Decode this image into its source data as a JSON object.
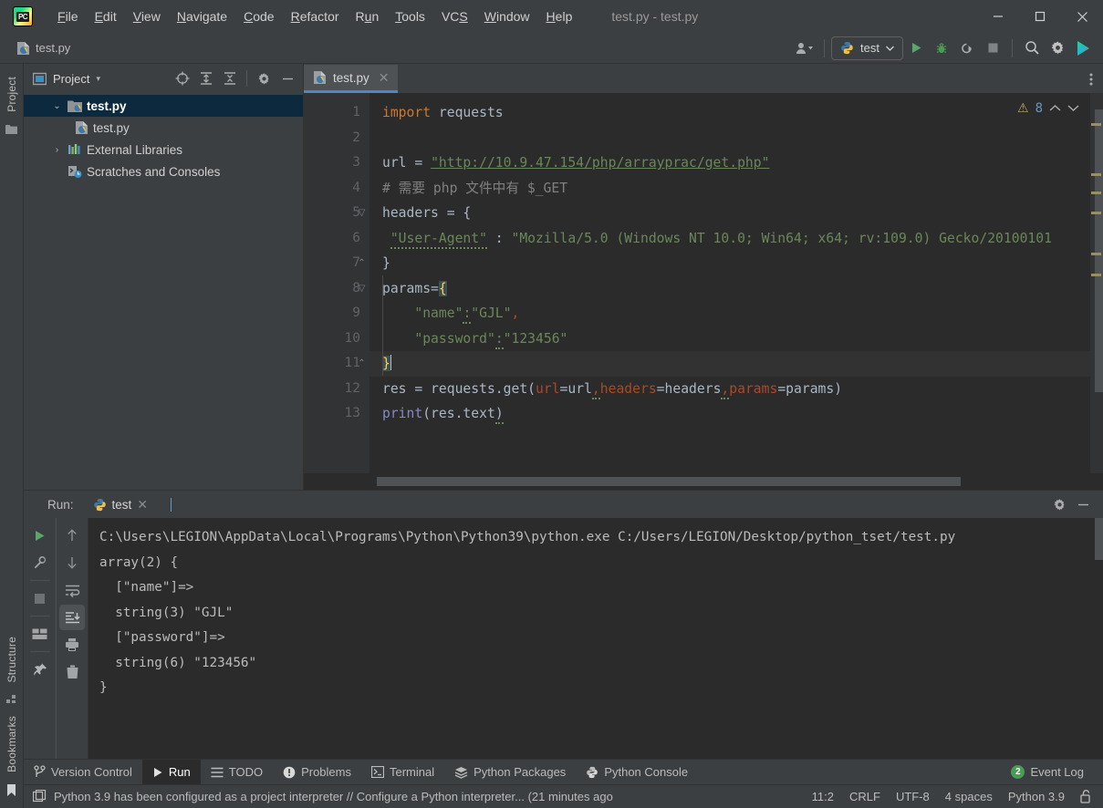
{
  "window": {
    "title": "test.py - test.py",
    "app_icon": "pycharm-logo-icon",
    "minimize": "–",
    "maximize": "□",
    "close": "✕"
  },
  "menubar": {
    "items": [
      {
        "label": "File",
        "mnemonic": "F"
      },
      {
        "label": "Edit",
        "mnemonic": "E"
      },
      {
        "label": "View",
        "mnemonic": "V"
      },
      {
        "label": "Navigate",
        "mnemonic": "N"
      },
      {
        "label": "Code",
        "mnemonic": "C"
      },
      {
        "label": "Refactor",
        "mnemonic": "R"
      },
      {
        "label": "Run",
        "mnemonic": "u"
      },
      {
        "label": "Tools",
        "mnemonic": "T"
      },
      {
        "label": "VCS",
        "mnemonic": "S"
      },
      {
        "label": "Window",
        "mnemonic": "W"
      },
      {
        "label": "Help",
        "mnemonic": "H"
      }
    ]
  },
  "navbar": {
    "breadcrumb": "test.py",
    "breadcrumb_icon": "python-file-icon",
    "account_icon": "user-account-icon",
    "run_config": {
      "label": "test",
      "icon": "python-icon",
      "chevron": "▾"
    },
    "buttons": [
      {
        "name": "run-button",
        "icon": "play-icon",
        "color": "#59a869"
      },
      {
        "name": "debug-button",
        "icon": "bug-icon",
        "color": "#499c54"
      },
      {
        "name": "run-with-coverage-button",
        "icon": "coverage-icon",
        "color": "#a9abad"
      },
      {
        "name": "stop-button",
        "icon": "stop-square-icon",
        "color": "#7f8386"
      },
      {
        "name": "search-everywhere-button",
        "icon": "search-icon",
        "color": "#c0c0c0"
      },
      {
        "name": "settings-button",
        "icon": "gear-icon",
        "color": "#c0c0c0"
      },
      {
        "name": "ai-assistant-button",
        "icon": "play-colored-icon",
        "color": "#21d789"
      }
    ]
  },
  "left_strip": {
    "project_label": "Project",
    "project_folder_icon": "folder-icon",
    "structure_label": "Structure",
    "structure_icon": "structure-icon",
    "bookmarks_label": "Bookmarks",
    "bookmarks_icon": "bookmark-icon"
  },
  "project_panel": {
    "title": "Project",
    "title_icon": "project-window-icon",
    "chevron": "▾",
    "toolbar": [
      {
        "name": "select-opened-file-button",
        "icon": "crosshair-icon"
      },
      {
        "name": "expand-all-button",
        "icon": "expand-all-icon"
      },
      {
        "name": "collapse-all-button",
        "icon": "collapse-all-icon"
      },
      {
        "name": "panel-options-button",
        "icon": "gear-icon"
      },
      {
        "name": "hide-panel-button",
        "icon": "minus-icon"
      }
    ],
    "tree": [
      {
        "label": "test.py",
        "icon": "project-folder-icon",
        "arrow": "⌄",
        "level": 1,
        "selected": true,
        "bold": true
      },
      {
        "label": "test.py",
        "icon": "python-file-icon",
        "arrow": "",
        "level": 2,
        "selected": false,
        "bold": false
      },
      {
        "label": "External Libraries",
        "icon": "libraries-icon",
        "arrow": "›",
        "level": 1,
        "selected": false,
        "bold": false
      },
      {
        "label": "Scratches and Consoles",
        "icon": "scratches-icon",
        "arrow": "",
        "level": 1,
        "selected": false,
        "bold": false
      }
    ]
  },
  "editor": {
    "tab": {
      "label": "test.py",
      "icon": "python-file-icon",
      "close": "✕"
    },
    "more_icon": "vertical-dots-icon",
    "inspections": {
      "warning_icon": "warning-triangle-icon",
      "count": "8",
      "prev": "⌃",
      "next": "⌄"
    },
    "lines": [
      {
        "n": "1",
        "html": "<span class='k'>import</span> requests"
      },
      {
        "n": "2",
        "html": ""
      },
      {
        "n": "3",
        "html": "url = <span class='s url'>\"http://10.9.47.154/php/arrayprac/get.php\"</span>"
      },
      {
        "n": "4",
        "html": "<span class='cm'># 需要 php 文件中有 $_GET</span>"
      },
      {
        "n": "5",
        "html": "headers = {"
      },
      {
        "n": "6",
        "html": " <span class='s squig'>\"User-Agent\"</span> : <span class='s'>\"Mozilla/5.0 (Windows NT 10.0; Win64; x64; rv:109.0) Gecko/20100101</span>"
      },
      {
        "n": "7",
        "html": "}"
      },
      {
        "n": "8",
        "html": "params=<span class='brace-hl'>{</span>"
      },
      {
        "n": "9",
        "html": "    <span class='s'>\"name\"</span><span class='s squig'>:</span><span class='s'>\"GJL\"</span><span class='kwarg'>,</span>"
      },
      {
        "n": "10",
        "html": "    <span class='s'>\"password\"</span><span class='s squig'>:</span><span class='s'>\"123456\"</span>"
      },
      {
        "n": "11",
        "html": "<span class='brace-hl'>}</span><span class='caret'></span>",
        "current": true
      },
      {
        "n": "12",
        "html": "res = requests.get(<span class='kwarg'>url</span>=url<span class='kwarg squig'>,</span><span class='kwarg'>headers</span>=headers<span class='kwarg squig'>,</span><span class='kwarg'>params</span>=params)"
      },
      {
        "n": "13",
        "html": "<span class='fn'>print</span>(res.text<span class='squig'>)</span>"
      }
    ],
    "source_text": [
      "import requests",
      "",
      "url = \"http://10.9.47.154/php/arrayprac/get.php\"",
      "# 需要 php 文件中有 $_GET",
      "headers = {",
      " \"User-Agent\" : \"Mozilla/5.0 (Windows NT 10.0; Win64; x64; rv:109.0) Gecko/20100101",
      "}",
      "params={",
      "    \"name\":\"GJL\",",
      "    \"password\":\"123456\"",
      "}",
      "res = requests.get(url=url,headers=headers,params=params)",
      "print(res.text)"
    ]
  },
  "run_panel": {
    "label": "Run:",
    "tab": {
      "label": "test",
      "icon": "python-icon",
      "close": "✕"
    },
    "settings_icon": "gear-icon",
    "hide_icon": "minus-icon",
    "left_tools": [
      {
        "name": "rerun-button",
        "icon": "play-icon"
      },
      {
        "name": "edit-configuration-button",
        "icon": "wrench-icon"
      },
      {
        "name": "stop-button",
        "icon": "stop-square-icon"
      },
      {
        "name": "layout-settings-button",
        "icon": "layout-icon"
      },
      {
        "name": "pin-tab-button",
        "icon": "pin-icon"
      }
    ],
    "right_tools": [
      {
        "name": "previous-occurrence-button",
        "icon": "arrow-up-icon"
      },
      {
        "name": "next-occurrence-button",
        "icon": "arrow-down-icon"
      },
      {
        "name": "soft-wrap-button",
        "icon": "wrap-icon"
      },
      {
        "name": "scroll-to-end-button",
        "icon": "scroll-end-icon",
        "selected": true
      },
      {
        "name": "print-button",
        "icon": "printer-icon"
      },
      {
        "name": "clear-all-button",
        "icon": "trash-icon"
      }
    ],
    "console_output": [
      "C:\\Users\\LEGION\\AppData\\Local\\Programs\\Python\\Python39\\python.exe C:/Users/LEGION/Desktop/python_tset/test.py",
      "array(2) {",
      "  [\"name\"]=>",
      "  string(3) \"GJL\"",
      "  [\"password\"]=>",
      "  string(6) \"123456\"",
      "}"
    ]
  },
  "toolwindow_bar": {
    "left": [
      {
        "label": "Version Control",
        "icon": "branch-icon",
        "active": false
      },
      {
        "label": "Run",
        "icon": "play-icon",
        "active": true
      },
      {
        "label": "TODO",
        "icon": "list-icon",
        "active": false
      },
      {
        "label": "Problems",
        "icon": "exclamation-circle-icon",
        "active": false
      },
      {
        "label": "Terminal",
        "icon": "terminal-icon",
        "active": false
      },
      {
        "label": "Python Packages",
        "icon": "packages-icon",
        "active": false
      },
      {
        "label": "Python Console",
        "icon": "python-icon",
        "active": false
      }
    ],
    "right": [
      {
        "label": "Event Log",
        "icon": "event-log-icon",
        "badge": "2",
        "badge_color": "#499c54"
      }
    ]
  },
  "statusbar": {
    "icon": "memory-indicator-icon",
    "message": "Python 3.9 has been configured as a project interpreter // Configure a Python interpreter... (21 minutes ago",
    "caret_position": "11:2",
    "line_separator": "CRLF",
    "encoding": "UTF-8",
    "indent": "4 spaces",
    "interpreter": "Python 3.9",
    "lock_icon": "unlocked-padlock-icon"
  },
  "colors": {
    "chrome_bg": "#3c3f41",
    "editor_bg": "#2b2b2b",
    "gutter_bg": "#313335",
    "accent_blue": "#4a88c7",
    "selection_blue": "#0d293e",
    "string_green": "#6a8759",
    "keyword_orange": "#cc7832",
    "number_blue": "#6897bb",
    "comment_grey": "#808080",
    "kwarg_red": "#aa4926",
    "badge_green": "#499c54"
  }
}
